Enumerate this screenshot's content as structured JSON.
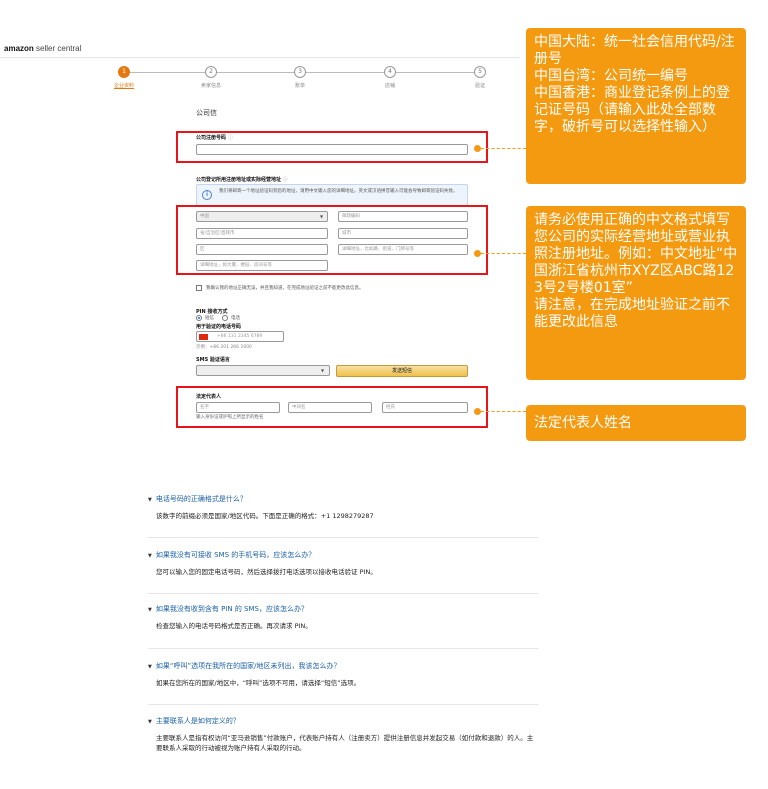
{
  "header": {
    "logo_brand": "amazon",
    "logo_sub": "seller central"
  },
  "steps": [
    {
      "num": "1",
      "label": "企业资料",
      "active": true
    },
    {
      "num": "2",
      "label": "卖家信息",
      "active": false
    },
    {
      "num": "3",
      "label": "账单",
      "active": false
    },
    {
      "num": "4",
      "label": "店铺",
      "active": false
    },
    {
      "num": "5",
      "label": "验证",
      "active": false
    }
  ],
  "form": {
    "title": "公司信",
    "reg_number_label": "公司注册号码",
    "address_label": "公司登记所用注册地址或实际经营地址",
    "info_text": "我们将邮寄一个地址验证码到您的地址，请用中文输入您的详细地址。英文或汉语拼音输入可能会导致邮寄验证码失败。",
    "country_placeholder": "中国",
    "postal_placeholder": "邮政编码",
    "province_placeholder": "省/自治区/直辖市",
    "city_placeholder": "城市",
    "district_placeholder": "区",
    "address1_placeholder": "详细地址，比如路、街道、门牌号等",
    "address2_placeholder": "详细地址，如大厦、楼层、房间号等",
    "confirm_text": "我确认我的地址正确无误，并且我知道，在完成地址验证之前不能更改此信息。",
    "pin_label": "PIN 接收方式",
    "pin_sms": "短信",
    "pin_call": "电话",
    "phone_label": "用于验证的电话号码",
    "phone_placeholder": "+86 131 2345 6789",
    "phone_example": "示例：+86 201 266 1000",
    "sms_lang_label": "SMS 验证语言",
    "send_sms_button": "发送短信",
    "legal_rep_label": "法定代表人",
    "first_name_placeholder": "名字",
    "middle_name_placeholder": "中间名",
    "last_name_placeholder": "姓氏",
    "legal_rep_hint": "输入身份证或护照上所显示的姓名"
  },
  "callouts": {
    "c1": "中国大陆：统一社会信用代码/注册号\n中国台湾：公司统一编号\n中国香港：商业登记条例上的登记证号码（请输入此处全部数字，破折号可以选择性输入）",
    "c2": "请务必使用正确的中文格式填写您公司的实际经营地址或营业执照注册地址。例如：中文地址“中国浙江省杭州市XYZ区ABC路123号2号楼01室”\n请注意，在完成地址验证之前不能更改此信息",
    "c3": "法定代表人姓名"
  },
  "faq": [
    {
      "q": "电话号码的正确格式是什么？",
      "a": "该数字的前缀必须是国家/地区代码。下面是正确的格式：+1 1298279287"
    },
    {
      "q": "如果我没有可接收 SMS 的手机号码，应该怎么办？",
      "a": "您可以输入您的固定电话号码，然后选择拨打电话选项以接收电话验证 PIN。"
    },
    {
      "q": "如果我没有收到含有 PIN 的 SMS，应该怎么办？",
      "a": "检查您输入的电话号码格式是否正确。再次请求 PIN。"
    },
    {
      "q": "如果“呼叫”选项在我所在的国家/地区未列出，我该怎么办？",
      "a": "如果在您所在的国家/地区中，“呼叫”选项不可用，请选择“短信”选项。"
    },
    {
      "q": "主要联系人是如何定义的？",
      "a": "主要联系人是指有权访问“亚马逊销售”付款账户，代表账户持有人（注册卖方）提供注册信息并发起交易（如付款和退款）的人。主要联系人采取的行动被视为账户持有人采取的行动。"
    }
  ],
  "colors": {
    "accent": "#f39a10",
    "highlight": "#e5161a",
    "link": "#1a5fa8"
  }
}
